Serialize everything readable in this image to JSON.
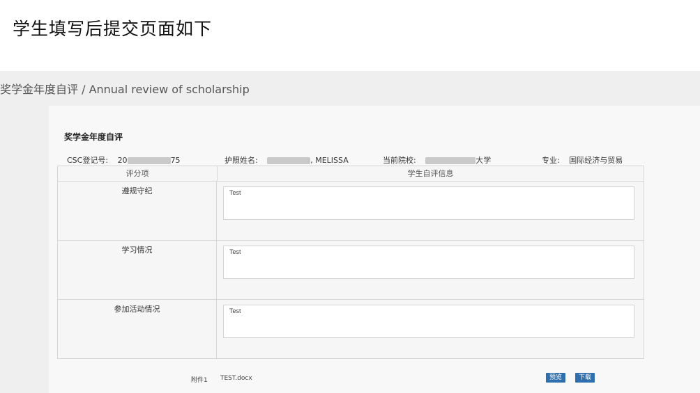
{
  "slide": {
    "title": "学生填写后提交页面如下"
  },
  "page": {
    "heading": "奖学金年度自评 / Annual review of scholarship"
  },
  "form": {
    "title": "奖学金年度自评",
    "csc_label": "CSC登记号:",
    "csc_value_start": "20",
    "csc_value_end": "75",
    "passport_label": "护照姓名:",
    "passport_value_end": ", MELISSA",
    "school_label": "当前院校:",
    "school_value_end": "大学",
    "major_label": "专业:",
    "major_value": "国际经济与贸易"
  },
  "table": {
    "headers": [
      "评分项",
      "学生自评信息"
    ],
    "rows": [
      {
        "item": "遵规守纪",
        "value": "Test"
      },
      {
        "item": "学习情况",
        "value": "Test"
      },
      {
        "item": "参加活动情况",
        "value": "Test"
      }
    ]
  },
  "attachment": {
    "label": "附件1",
    "filename": "TEST.docx",
    "preview_label": "预览",
    "download_label": "下载"
  },
  "colors": {
    "button": "#2f6fae",
    "background": "#efefef"
  }
}
